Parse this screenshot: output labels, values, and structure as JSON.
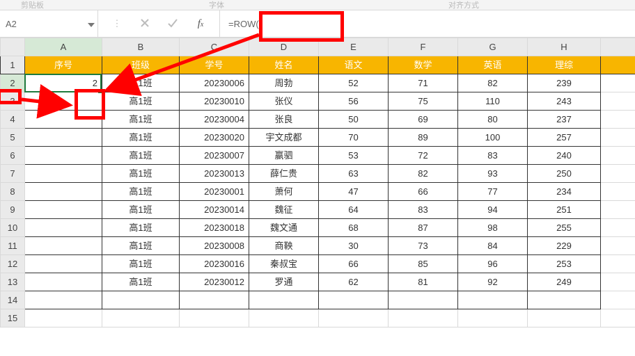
{
  "ribbon": {
    "left_label": "剪贴板",
    "mid_label": "字体",
    "right_label": "对齐方式"
  },
  "namebox": {
    "value": "A2"
  },
  "formula_bar": {
    "value": "=ROW()"
  },
  "columns": [
    "A",
    "B",
    "C",
    "D",
    "E",
    "F",
    "G",
    "H"
  ],
  "header_row": [
    "序号",
    "班级",
    "学号",
    "姓名",
    "语文",
    "数学",
    "英语",
    "理综"
  ],
  "rows": [
    {
      "n": 2,
      "cells": [
        "2",
        "高1班",
        "20230006",
        "周勃",
        "52",
        "71",
        "82",
        "239"
      ]
    },
    {
      "n": 3,
      "cells": [
        "",
        "高1班",
        "20230010",
        "张仪",
        "56",
        "75",
        "110",
        "243"
      ]
    },
    {
      "n": 4,
      "cells": [
        "",
        "高1班",
        "20230004",
        "张良",
        "50",
        "69",
        "80",
        "237"
      ]
    },
    {
      "n": 5,
      "cells": [
        "",
        "高1班",
        "20230020",
        "宇文成都",
        "70",
        "89",
        "100",
        "257"
      ]
    },
    {
      "n": 6,
      "cells": [
        "",
        "高1班",
        "20230007",
        "嬴驷",
        "53",
        "72",
        "83",
        "240"
      ]
    },
    {
      "n": 7,
      "cells": [
        "",
        "高1班",
        "20230013",
        "薛仁贵",
        "63",
        "82",
        "93",
        "250"
      ]
    },
    {
      "n": 8,
      "cells": [
        "",
        "高1班",
        "20230001",
        "萧何",
        "47",
        "66",
        "77",
        "234"
      ]
    },
    {
      "n": 9,
      "cells": [
        "",
        "高1班",
        "20230014",
        "魏征",
        "64",
        "83",
        "94",
        "251"
      ]
    },
    {
      "n": 10,
      "cells": [
        "",
        "高1班",
        "20230018",
        "魏文通",
        "68",
        "87",
        "98",
        "255"
      ]
    },
    {
      "n": 11,
      "cells": [
        "",
        "高1班",
        "20230008",
        "商鞅",
        "30",
        "73",
        "84",
        "229"
      ]
    },
    {
      "n": 12,
      "cells": [
        "",
        "高1班",
        "20230016",
        "秦叔宝",
        "66",
        "85",
        "96",
        "253"
      ]
    },
    {
      "n": 13,
      "cells": [
        "",
        "高1班",
        "20230012",
        "罗通",
        "62",
        "81",
        "92",
        "249"
      ]
    }
  ],
  "blank_rows": [
    14,
    15
  ],
  "chart_data": {
    "type": "table",
    "title": "",
    "columns": [
      "序号",
      "班级",
      "学号",
      "姓名",
      "语文",
      "数学",
      "英语",
      "理综"
    ],
    "records": [
      {
        "序号": 2,
        "班级": "高1班",
        "学号": "20230006",
        "姓名": "周勃",
        "语文": 52,
        "数学": 71,
        "英语": 82,
        "理综": 239
      },
      {
        "序号": null,
        "班级": "高1班",
        "学号": "20230010",
        "姓名": "张仪",
        "语文": 56,
        "数学": 75,
        "英语": 110,
        "理综": 243
      },
      {
        "序号": null,
        "班级": "高1班",
        "学号": "20230004",
        "姓名": "张良",
        "语文": 50,
        "数学": 69,
        "英语": 80,
        "理综": 237
      },
      {
        "序号": null,
        "班级": "高1班",
        "学号": "20230020",
        "姓名": "宇文成都",
        "语文": 70,
        "数学": 89,
        "英语": 100,
        "理综": 257
      },
      {
        "序号": null,
        "班级": "高1班",
        "学号": "20230007",
        "姓名": "嬴驷",
        "语文": 53,
        "数学": 72,
        "英语": 83,
        "理综": 240
      },
      {
        "序号": null,
        "班级": "高1班",
        "学号": "20230013",
        "姓名": "薛仁贵",
        "语文": 63,
        "数学": 82,
        "英语": 93,
        "理综": 250
      },
      {
        "序号": null,
        "班级": "高1班",
        "学号": "20230001",
        "姓名": "萧何",
        "语文": 47,
        "数学": 66,
        "英语": 77,
        "理综": 234
      },
      {
        "序号": null,
        "班级": "高1班",
        "学号": "20230014",
        "姓名": "魏征",
        "语文": 64,
        "数学": 83,
        "英语": 94,
        "理综": 251
      },
      {
        "序号": null,
        "班级": "高1班",
        "学号": "20230018",
        "姓名": "魏文通",
        "语文": 68,
        "数学": 87,
        "英语": 98,
        "理综": 255
      },
      {
        "序号": null,
        "班级": "高1班",
        "学号": "20230008",
        "姓名": "商鞅",
        "语文": 30,
        "数学": 73,
        "英语": 84,
        "理综": 229
      },
      {
        "序号": null,
        "班级": "高1班",
        "学号": "20230016",
        "姓名": "秦叔宝",
        "语文": 66,
        "数学": 85,
        "英语": 96,
        "理综": 253
      },
      {
        "序号": null,
        "班级": "高1班",
        "学号": "20230012",
        "姓名": "罗通",
        "语文": 62,
        "数学": 81,
        "英语": 92,
        "理综": 249
      }
    ]
  }
}
